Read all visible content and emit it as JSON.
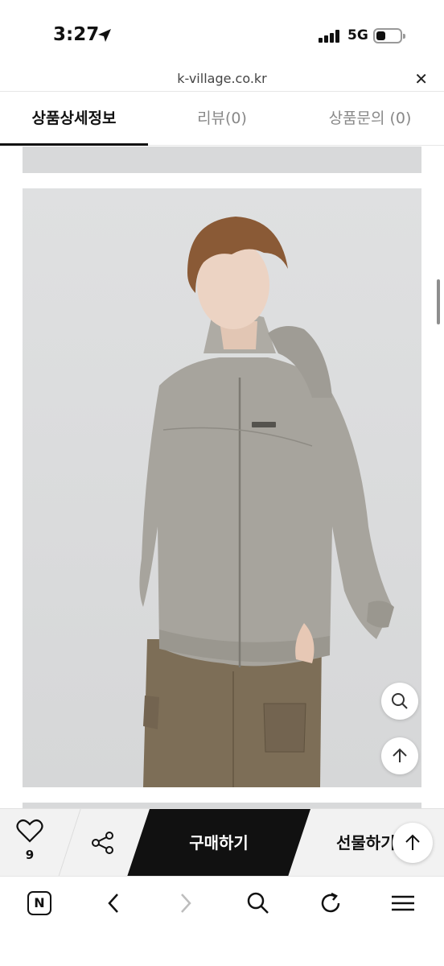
{
  "status_bar": {
    "time": "3:27",
    "network": "5G",
    "battery_level": 0.4
  },
  "url_bar": {
    "url": "k-village.co.kr",
    "close_icon": "close-icon"
  },
  "tabs": [
    {
      "label": "상품상세정보",
      "active": true
    },
    {
      "label": "리뷰(0)",
      "active": false
    },
    {
      "label": "상품문의 (0)",
      "active": false
    }
  ],
  "content": {
    "photo": "product-photo-model-grey-hooded-zip-jacket-khaki-cargo-pants",
    "floating_buttons": [
      "zoom-icon",
      "arrow-up-icon"
    ]
  },
  "purchase_bar": {
    "like_count": "9",
    "buy_label": "구매하기",
    "gift_label": "선물하기"
  },
  "toolbar": {
    "icons": [
      "naver-home-icon",
      "back-icon",
      "forward-icon",
      "search-icon",
      "reload-icon",
      "menu-icon"
    ]
  },
  "colors": {
    "accent": "#111111",
    "background": "#ffffff",
    "photo_bg": "#d9dadb",
    "bar_bg": "#f2f2f2"
  }
}
